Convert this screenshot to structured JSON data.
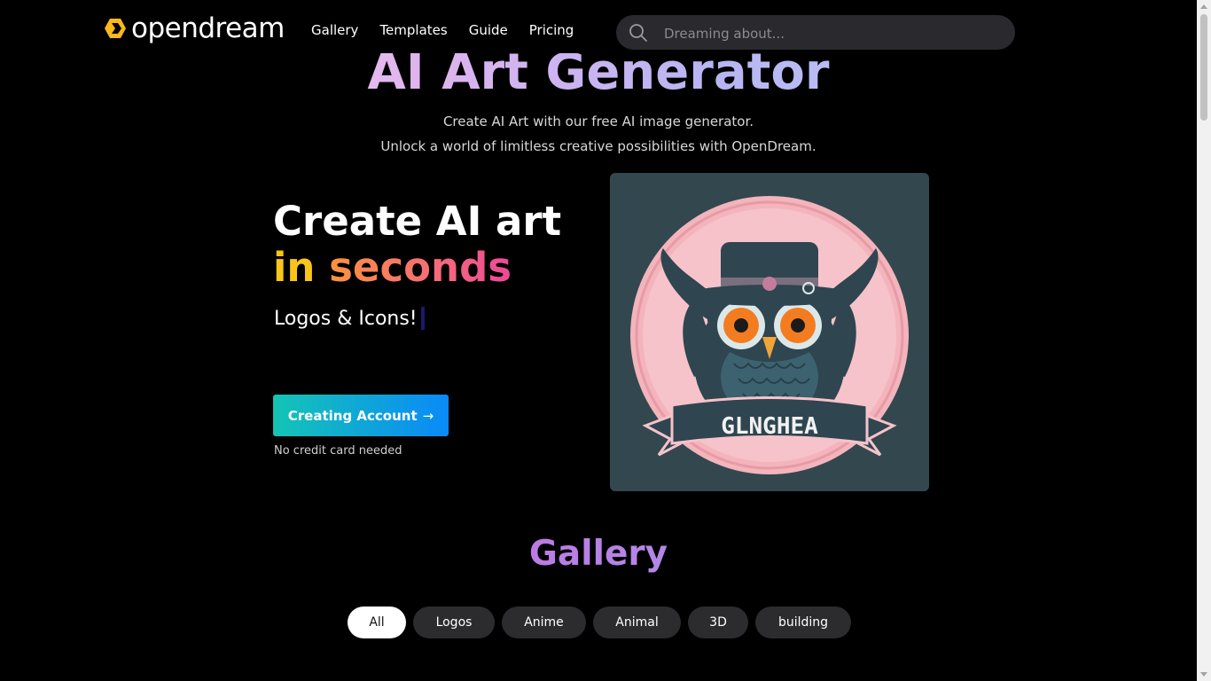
{
  "header": {
    "brand": "opendream",
    "nav": [
      {
        "label": "Gallery"
      },
      {
        "label": "Templates"
      },
      {
        "label": "Guide"
      },
      {
        "label": "Pricing"
      }
    ],
    "search": {
      "placeholder": "Dreaming about..."
    }
  },
  "hero": {
    "title": "AI Art Generator",
    "subtitle_1": "Create AI Art with our free AI image generator.",
    "subtitle_2": "Unlock a world of limitless creative possibilities with OpenDream.",
    "headline_1": "Create AI art",
    "headline_2a": "in",
    "headline_2b": "seconds",
    "typing_text": "Logos & Icons!",
    "cta_label": "Creating Account",
    "cta_arrow": "→",
    "cta_note": "No credit card needed"
  },
  "art": {
    "banner_text": "GLNGHEA"
  },
  "gallery": {
    "title": "Gallery",
    "filters": [
      {
        "label": "All",
        "active": true
      },
      {
        "label": "Logos"
      },
      {
        "label": "Anime"
      },
      {
        "label": "Animal"
      },
      {
        "label": "3D"
      },
      {
        "label": "building"
      }
    ]
  },
  "colors": {
    "background": "#000000",
    "accent_yellow": "#f9c51b",
    "cta_start": "#14c4b5",
    "cta_end": "#0a8af8",
    "art_background": "#33474f",
    "art_circle": "#f5b5bd"
  }
}
